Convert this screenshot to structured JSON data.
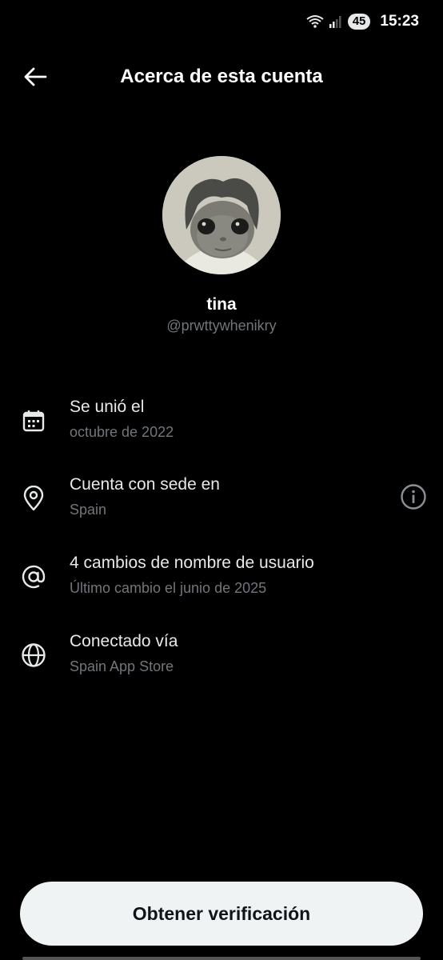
{
  "status_bar": {
    "time": "15:23",
    "battery": "45",
    "icons": [
      "wifi-icon",
      "signal-icon",
      "battery-icon"
    ]
  },
  "header": {
    "title": "Acerca de esta cuenta",
    "back_icon": "arrow-left-icon"
  },
  "profile": {
    "display_name": "tina",
    "handle": "@prwttywhenikry",
    "avatar": "profile-photo"
  },
  "info_rows": [
    {
      "icon": "calendar-icon",
      "title": "Se unió el",
      "subtitle": "octubre de 2022"
    },
    {
      "icon": "location-pin-icon",
      "title": "Cuenta con sede en",
      "subtitle": "Spain",
      "action_icon": "info-icon"
    },
    {
      "icon": "at-sign-icon",
      "title": "4 cambios de nombre de usuario",
      "subtitle": "Último cambio el junio de 2025"
    },
    {
      "icon": "globe-icon",
      "title": "Conectado vía",
      "subtitle": "Spain App Store"
    }
  ],
  "cta": {
    "label": "Obtener verificación"
  },
  "colors": {
    "background": "#000000",
    "primary_text": "#e7e9ea",
    "secondary_text": "#71767b",
    "button_bg": "#eff3f4",
    "button_text": "#0f1419"
  }
}
